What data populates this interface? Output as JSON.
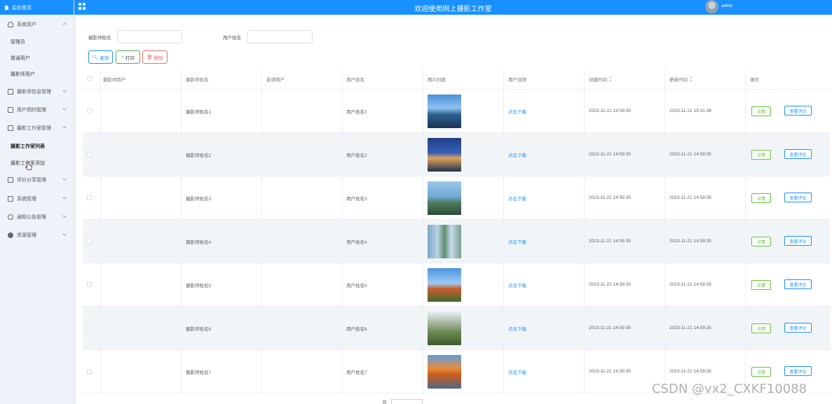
{
  "header": {
    "title": "欢迎使用网上摄影工作室",
    "user": "admin"
  },
  "sidebar": {
    "home": "后台首页",
    "menu": [
      {
        "label": "系统用户",
        "icon": "user-icon",
        "expanded": true
      },
      {
        "label": "摄影师信息管理",
        "icon": "edit-icon"
      },
      {
        "label": "用户预约管理",
        "icon": "edit-icon"
      },
      {
        "label": "摄影工作室管理",
        "icon": "edit-icon",
        "expanded": true
      },
      {
        "label": "评价分享管理",
        "icon": "edit-icon"
      },
      {
        "label": "系统管理",
        "icon": "monitor-icon"
      },
      {
        "label": "通知公告管理",
        "icon": "info-icon"
      },
      {
        "label": "资源管理",
        "icon": "settings-icon"
      }
    ],
    "system_users_sub": [
      "管理员",
      "普通用户",
      "摄影师用户"
    ],
    "studio_sub": [
      "摄影工作室列表",
      "摄影工作室添加"
    ]
  },
  "search": {
    "photographer_name_label": "摄影师姓名",
    "user_name_label": "用户姓名",
    "query_label": "查询",
    "print_label": "打印",
    "delete_label": "删除"
  },
  "table": {
    "columns": [
      "摄影师用户",
      "摄影师姓名",
      "普通用户",
      "用户姓名",
      "图片封面",
      "用户视频",
      "创建时间",
      "更新时间",
      "操作"
    ],
    "rows": [
      {
        "photographer": "摄影师姓名1",
        "user": "用户姓名1",
        "video": "点击下载",
        "created": "2023-11-21 14:59:35",
        "updated": "2023-11-21 15:31:38"
      },
      {
        "photographer": "摄影师姓名2",
        "user": "用户姓名2",
        "video": "点击下载",
        "created": "2023-11-21 14:59:35",
        "updated": "2023-11-21 14:59:35"
      },
      {
        "photographer": "摄影师姓名3",
        "user": "用户姓名3",
        "video": "点击下载",
        "created": "2023-11-21 14:59:35",
        "updated": "2023-11-21 14:59:35"
      },
      {
        "photographer": "摄影师姓名4",
        "user": "用户姓名4",
        "video": "点击下载",
        "created": "2023-11-21 14:59:35",
        "updated": "2023-11-21 14:59:35"
      },
      {
        "photographer": "摄影师姓名5",
        "user": "用户姓名5",
        "video": "点击下载",
        "created": "2023-11-21 14:59:35",
        "updated": "2023-11-21 14:59:35"
      },
      {
        "photographer": "摄影师姓名6",
        "user": "用户姓名6",
        "video": "点击下载",
        "created": "2023-11-21 14:59:35",
        "updated": "2023-11-21 14:59:35"
      },
      {
        "photographer": "摄影师姓名7",
        "user": "用户姓名7",
        "video": "点击下载",
        "created": "2023-11-21 14:59:35",
        "updated": "2023-11-21 14:59:35"
      }
    ],
    "detail_label": "详情",
    "comment_label": "查看评论"
  },
  "colors": {
    "accent": "#1890ff",
    "success": "#67c23a",
    "danger": "#f56c6c"
  },
  "watermark": "CSDN @vx2_CXKF10088"
}
